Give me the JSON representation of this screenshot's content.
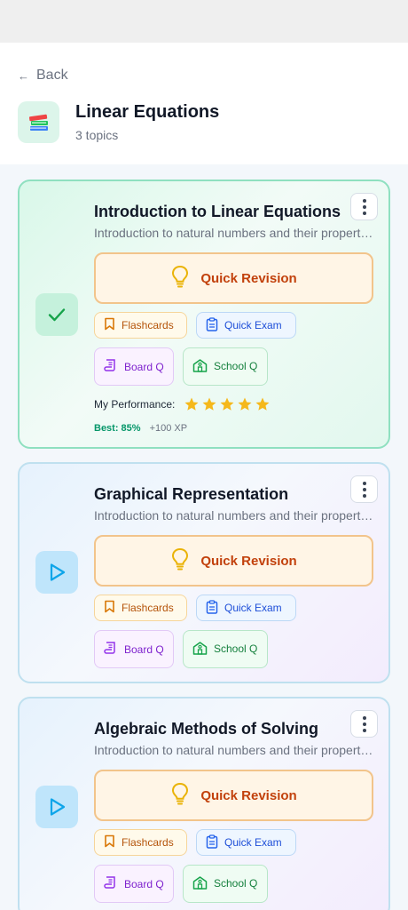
{
  "header": {
    "back_label": "Back",
    "title": "Linear Equations",
    "subtitle": "3 topics",
    "icon": "books-icon"
  },
  "labels": {
    "quick_revision": "Quick Revision",
    "flashcards": "Flashcards",
    "quick_exam": "Quick Exam",
    "board_q": "Board Q",
    "school_q": "School Q",
    "performance": "My Performance:"
  },
  "topics": [
    {
      "title": "Introduction to Linear Equations",
      "description": "Introduction to natural numbers and their properties",
      "status": "completed",
      "rating": 5,
      "best": "Best: 85%",
      "xp": "+100 XP"
    },
    {
      "title": "Graphical Representation",
      "description": "Introduction to natural numbers and their properties",
      "status": "not-started"
    },
    {
      "title": "Algebraic Methods of Solving",
      "description": "Introduction to natural numbers and their properties",
      "status": "not-started"
    }
  ],
  "colors": {
    "completed_border": "#8fe0c0",
    "pending_border": "#bfe0ef",
    "quick_revision_text": "#c2410c",
    "star": "#f5b81b"
  }
}
